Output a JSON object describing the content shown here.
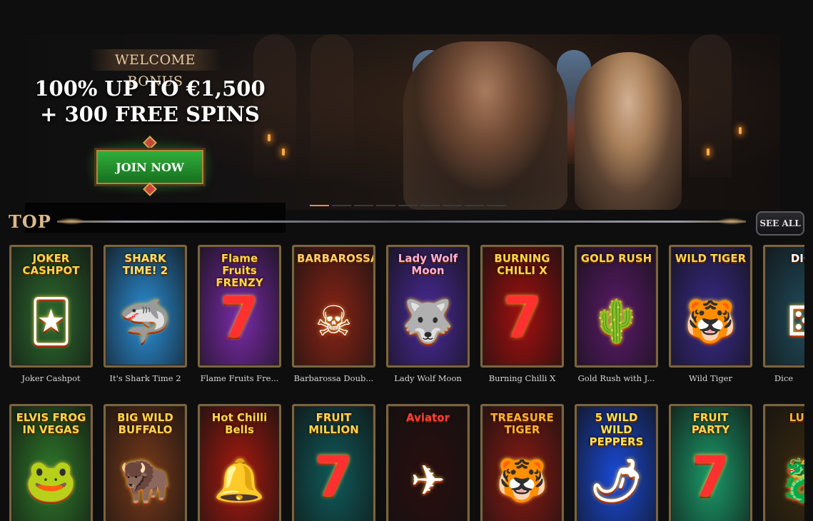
{
  "hero": {
    "bonus_tag": "WELCOME BONUS",
    "offer_line1": "100% UP TO €1,500",
    "offer_line2": "+ 300 FREE SPINS",
    "cta_label": "JOIN NOW",
    "slides_total": 9,
    "active_slide": 1
  },
  "section": {
    "title": "TOP",
    "see_all_label": "SEE ALL"
  },
  "games_row1": [
    {
      "name": "Joker Cashpot",
      "art": "JOKER CASHPOT",
      "bg": "#2c6a2f",
      "accent": "#ffd44a",
      "icon": "joker-icon"
    },
    {
      "name": "It's Shark Time 2",
      "art": "SHARK TIME! 2",
      "bg": "#2b8fd8",
      "accent": "#ffe066",
      "icon": "shark-icon"
    },
    {
      "name": "Flame Fruits Fre...",
      "art": "Flame Fruits FRENZY",
      "bg": "#7a2aa8",
      "accent": "#ffd44a",
      "icon": "seven-icon"
    },
    {
      "name": "Barbarossa Doub...",
      "art": "BARBAROSSA",
      "bg": "#8a2416",
      "accent": "#ffcf66",
      "icon": "pirate-icon"
    },
    {
      "name": "Lady Wolf Moon",
      "art": "Lady Wolf Moon",
      "bg": "#4a2a9a",
      "accent": "#ffb0d8",
      "icon": "wolf-icon"
    },
    {
      "name": "Burning Chilli X",
      "art": "BURNING CHILLI X",
      "bg": "#a21010",
      "accent": "#ffd44a",
      "icon": "seven-icon"
    },
    {
      "name": "Gold Rush with J...",
      "art": "GOLD RUSH",
      "bg": "#5a1a6a",
      "accent": "#ffd44a",
      "icon": "cactus-icon"
    },
    {
      "name": "Wild Tiger",
      "art": "WILD TIGER",
      "bg": "#3a2a8a",
      "accent": "#ffd44a",
      "icon": "tiger-icon"
    },
    {
      "name": "Dice",
      "art": "DICE",
      "bg": "#1f4a5a",
      "accent": "#ffffff",
      "icon": "dice-icon"
    }
  ],
  "games_row2": [
    {
      "name": "",
      "art": "ELVIS FROG IN VEGAS",
      "bg": "#2f7a2a",
      "accent": "#ffd44a",
      "icon": "frog-icon"
    },
    {
      "name": "",
      "art": "BIG WILD BUFFALO",
      "bg": "#7a3a1a",
      "accent": "#ffd44a",
      "icon": "buffalo-icon"
    },
    {
      "name": "",
      "art": "Hot Chilli Bells",
      "bg": "#a81a10",
      "accent": "#ffd44a",
      "icon": "bell-icon"
    },
    {
      "name": "",
      "art": "FRUIT MILLION",
      "bg": "#0f5a5a",
      "accent": "#ffd44a",
      "icon": "seven-icon"
    },
    {
      "name": "",
      "art": "Aviator",
      "bg": "#2a0e0e",
      "accent": "#ff3a3a",
      "icon": "plane-icon"
    },
    {
      "name": "",
      "art": "TREASURE TIGER",
      "bg": "#8a1a12",
      "accent": "#ffb030",
      "icon": "tiger-icon"
    },
    {
      "name": "",
      "art": "5 WILD WILD PEPPERS",
      "bg": "#1a4ad8",
      "accent": "#ffe24a",
      "icon": "pepper-icon"
    },
    {
      "name": "",
      "art": "FRUIT PARTY",
      "bg": "#1a9a6a",
      "accent": "#ffd44a",
      "icon": "seven-icon"
    },
    {
      "name": "",
      "art": "LUCK",
      "bg": "#3a2a10",
      "accent": "#ffb030",
      "icon": "dragon-icon"
    }
  ]
}
